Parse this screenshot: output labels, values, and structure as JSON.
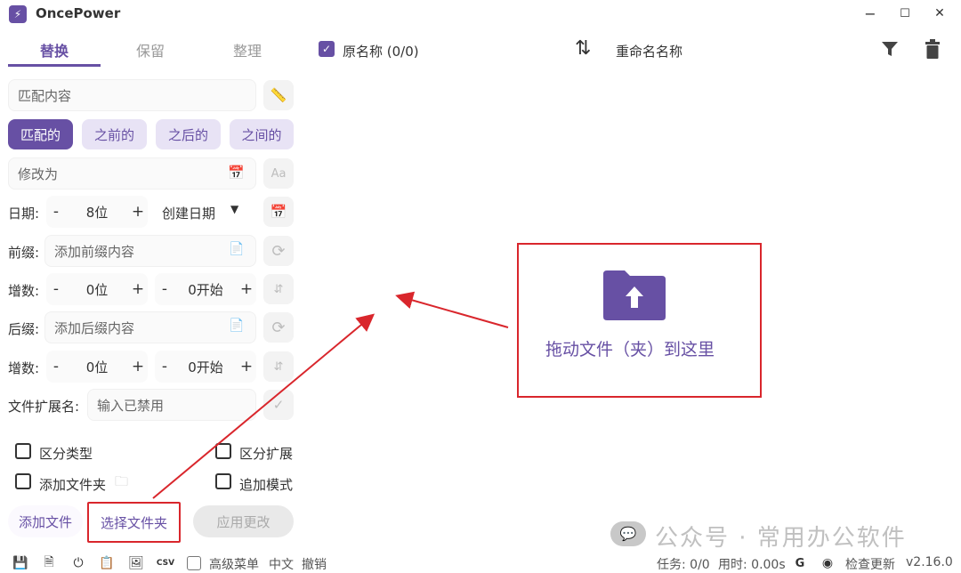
{
  "window": {
    "title": "OncePower",
    "min": "−",
    "max": "☐",
    "close": "✕"
  },
  "tabs": [
    {
      "label": "替换"
    },
    {
      "label": "保留"
    },
    {
      "label": "整理"
    }
  ],
  "header": {
    "original_name_label": "原名称 (0/0)",
    "rename_label": "重命名名称"
  },
  "replace": {
    "match_placeholder": "匹配内容",
    "chips": [
      "匹配的",
      "之前的",
      "之后的",
      "之间的"
    ],
    "modify_placeholder": "修改为"
  },
  "date": {
    "label": "日期:",
    "minus": "-",
    "plus": "+",
    "digits": "8位",
    "type": "创建日期"
  },
  "prefix": {
    "label": "前缀:",
    "placeholder": "添加前缀内容"
  },
  "increment1": {
    "label": "增数:",
    "digits": "0位",
    "start": "0开始",
    "minus": "-",
    "plus": "+"
  },
  "suffix": {
    "label": "后缀:",
    "placeholder": "添加后缀内容"
  },
  "increment2": {
    "label": "增数:",
    "digits": "0位",
    "start": "0开始",
    "minus": "-",
    "plus": "+"
  },
  "extension": {
    "label": "文件扩展名:",
    "placeholder": "输入已禁用"
  },
  "options": {
    "distinguish_type": "区分类型",
    "distinguish_ext": "区分扩展",
    "add_folder": "添加文件夹",
    "append_mode": "追加模式"
  },
  "actions": {
    "add_file": "添加文件",
    "select_folder": "选择文件夹",
    "apply": "应用更改"
  },
  "dropzone": {
    "text": "拖动文件（夹）到这里"
  },
  "statusbar": {
    "advanced_menu": "高级菜单",
    "language": "中文",
    "undo": "撤销",
    "tasks": "任务: 0/0",
    "time": "用时: 0.00s",
    "check_update": "检查更新",
    "version": "v2.16.0"
  },
  "watermark": {
    "text": "公众号 · 常用办公软件"
  },
  "colors": {
    "accent": "#6750a4",
    "chip_bg": "#e8e3f5",
    "annotation_red": "#d9262c"
  }
}
